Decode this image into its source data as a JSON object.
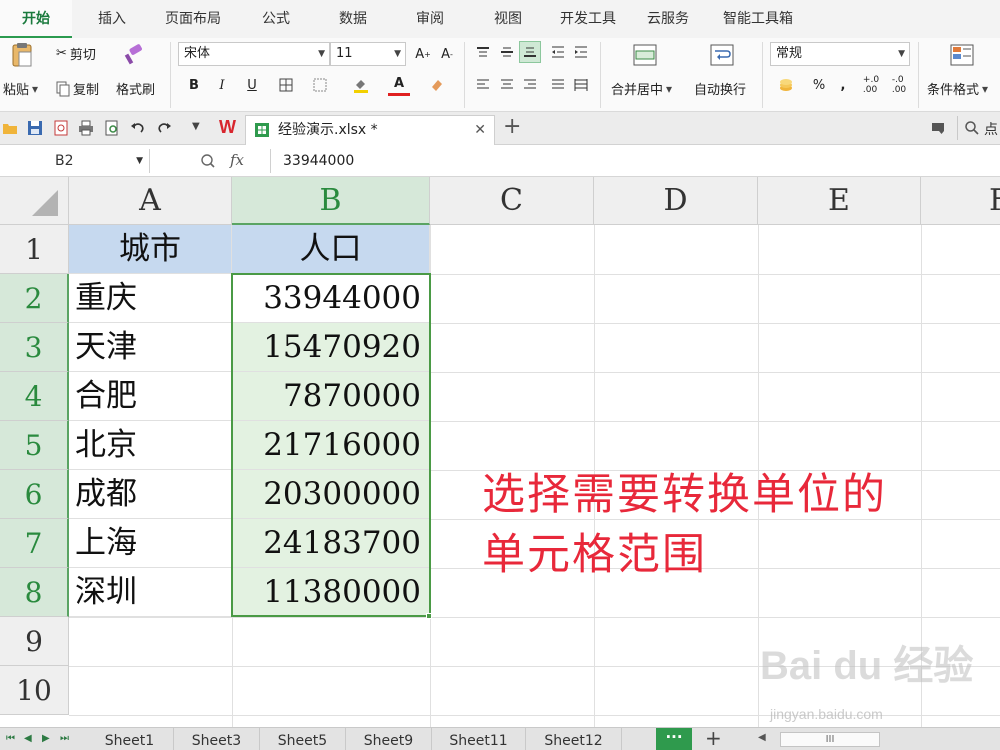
{
  "ribbon_tabs": [
    "开始",
    "插入",
    "页面布局",
    "公式",
    "数据",
    "审阅",
    "视图",
    "开发工具",
    "云服务",
    "智能工具箱"
  ],
  "ribbon": {
    "paste": "粘贴",
    "cut": "剪切",
    "copy": "复制",
    "format_painter": "格式刷",
    "font_name": "宋体",
    "font_size": "11",
    "merge_center": "合并居中",
    "wrap_text": "自动换行",
    "number_format": "常规",
    "conditional_format": "条件格式",
    "bold": "B",
    "italic": "I",
    "underline": "U",
    "percent": "%",
    "comma": ","
  },
  "quickbar": {
    "doc_tab": "经验演示.xlsx *",
    "search_hint": "点"
  },
  "formula_bar": {
    "name_box": "B2",
    "fx": "fx",
    "value": "33944000"
  },
  "sheet": {
    "columns": [
      "A",
      "B",
      "C",
      "D",
      "E",
      "F"
    ],
    "rows": [
      "1",
      "2",
      "3",
      "4",
      "5",
      "6",
      "7",
      "8",
      "9",
      "10"
    ],
    "header": [
      "城市",
      "人口"
    ],
    "data": [
      {
        "city": "重庆",
        "population": "33944000"
      },
      {
        "city": "天津",
        "population": "15470920"
      },
      {
        "city": "合肥",
        "population": "7870000"
      },
      {
        "city": "北京",
        "population": "21716000"
      },
      {
        "city": "成都",
        "population": "20300000"
      },
      {
        "city": "上海",
        "population": "24183700"
      },
      {
        "city": "深圳",
        "population": "11380000"
      }
    ],
    "annotation_line1": "选择需要转换单位的",
    "annotation_line2": "单元格范围"
  },
  "sheet_tabs": [
    "Sheet1",
    "Sheet3",
    "Sheet5",
    "Sheet9",
    "Sheet11",
    "Sheet12"
  ],
  "sheet_tab_more": "···",
  "sheet_tab_add": "+",
  "hscroll_label": "III",
  "watermark": {
    "brand": "Bai du 经验",
    "url": "jingyan.baidu.com"
  },
  "colors": {
    "accent_green": "#2f9a4d",
    "header_fill": "#c6d9ef",
    "selection_fill": "#e3f2e1",
    "annotation_red": "#e8283a"
  }
}
